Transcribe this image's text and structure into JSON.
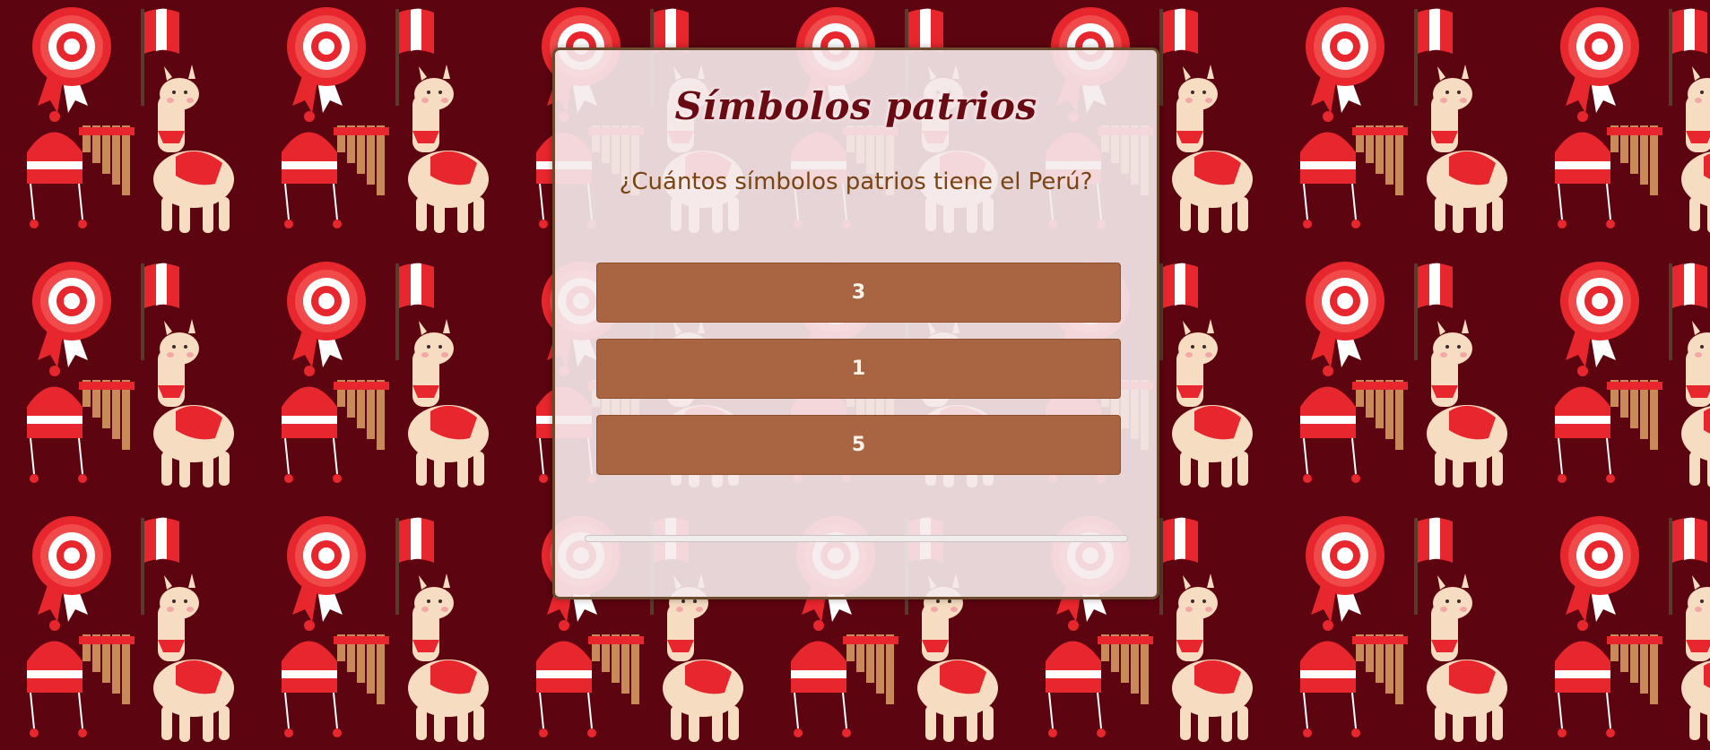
{
  "quiz": {
    "title": "Símbolos patrios",
    "question": "¿Cuántos símbolos patrios tiene el Perú?",
    "answers": [
      {
        "label": "3"
      },
      {
        "label": "1"
      },
      {
        "label": "5"
      }
    ],
    "progress": 0
  },
  "theme": {
    "background": "#5c0410",
    "button": "#a96442",
    "title_color": "#6a0b14",
    "question_color": "#7a4413",
    "border": "#6b4a2d"
  },
  "background_pattern": {
    "motifs": [
      "rosette-icon",
      "flag-icon",
      "llama-icon",
      "chullo-hat-icon",
      "panpipe-icon"
    ]
  }
}
